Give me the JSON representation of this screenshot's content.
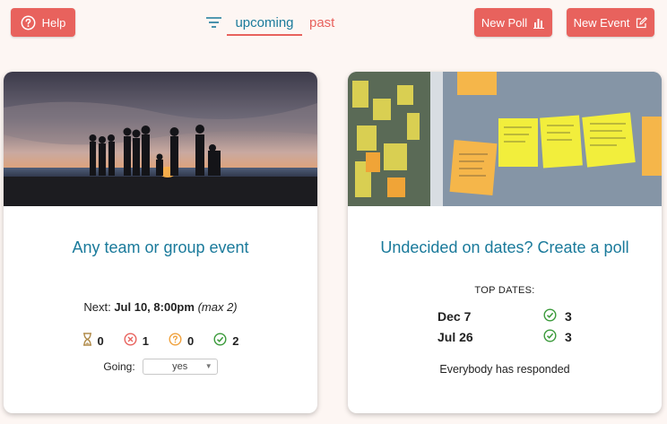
{
  "header": {
    "help_label": "Help",
    "tabs": [
      {
        "label": "upcoming",
        "active": true
      },
      {
        "label": "past",
        "active": false
      }
    ],
    "new_poll_label": "New Poll",
    "new_event_label": "New Event"
  },
  "colors": {
    "accent": "#e8625d",
    "title": "#1a7a9b",
    "background": "#fdf6f3"
  },
  "event_card": {
    "title": "Any team or group event",
    "next_prefix": "Next:",
    "next_date": "Jul 10, 8:00pm",
    "next_max": "(max 2)",
    "counts": {
      "pending": "0",
      "declined": "1",
      "maybe": "0",
      "accepted": "2"
    },
    "going_label": "Going:",
    "going_value": "yes",
    "image_icon": "campfire-beach-photo"
  },
  "poll_card": {
    "title": "Undecided on dates? Create a poll",
    "top_dates_label": "TOP DATES:",
    "dates": [
      {
        "date": "Dec 7",
        "count": "3"
      },
      {
        "date": "Jul 26",
        "count": "3"
      }
    ],
    "status": "Everybody has responded",
    "image_icon": "sticky-notes-photo"
  }
}
